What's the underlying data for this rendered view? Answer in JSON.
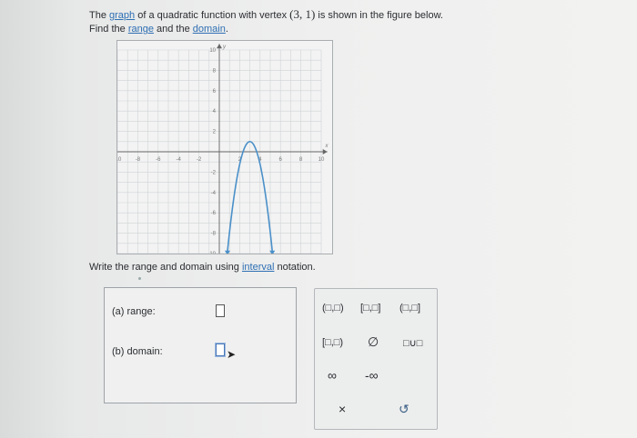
{
  "question": {
    "p1": "The",
    "graph_link": "graph",
    "p2": "of a quadratic function with vertex",
    "vertex": "(3, 1)",
    "p3": "is shown in the figure below.",
    "p4": "Find the",
    "range_link": "range",
    "p5": "and the",
    "domain_link": "domain",
    "p6": "."
  },
  "graph": {
    "x_ticks": [
      "-10",
      "-8",
      "-6",
      "-4",
      "-2",
      "2",
      "4",
      "6",
      "8",
      "10"
    ],
    "y_ticks": [
      "10",
      "8",
      "6",
      "4",
      "2",
      "-2",
      "-4",
      "-6",
      "-8",
      "-10"
    ],
    "x_axis_label": "x",
    "y_axis_label": "y",
    "vertex": [
      3,
      1
    ],
    "curve_color": "#4a90c9"
  },
  "instruction": {
    "p1": "Write the range and domain using",
    "interval_link": "interval",
    "p2": "notation."
  },
  "answers": {
    "range_label": "(a)  range:",
    "domain_label": "(b)  domain:"
  },
  "palette": {
    "open_open": "(□,□)",
    "closed_closed": "[□,□]",
    "open_closed": "(□,□]",
    "closed_open": "[□,□)",
    "empty_set": "∅",
    "union": "□∪□",
    "infinity": "∞",
    "neg_infinity": "-∞",
    "clear": "×",
    "undo": "↺"
  }
}
